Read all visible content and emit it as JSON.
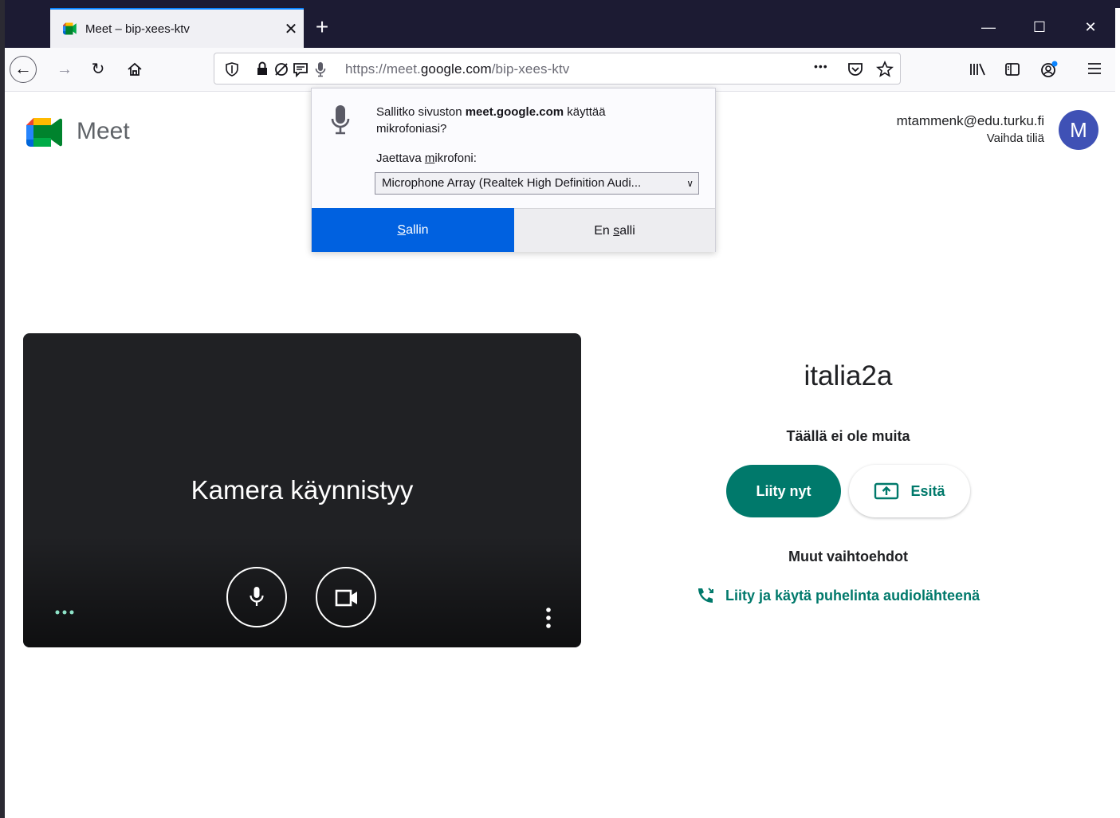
{
  "browser": {
    "tab_title": "Meet – bip-xees-ktv",
    "tab_close": "✕",
    "new_tab": "+",
    "window_controls": {
      "minimize": "—",
      "maximize": "☐",
      "close": "✕"
    },
    "url_prefix": "https://meet.",
    "url_domain": "google.com",
    "url_suffix": "/bip-xees-ktv",
    "url_more": "•••"
  },
  "permission_popup": {
    "question_prefix": "Sallitko sivuston ",
    "question_site": "meet.google.com",
    "question_suffix": " käyttää mikrofoniasi?",
    "mic_label_pre": "Jaettava ",
    "mic_label_key": "m",
    "mic_label_post": "ikrofoni:",
    "mic_selected": "Microphone Array (Realtek High Definition Audi...",
    "allow_key": "S",
    "allow_rest": "allin",
    "deny_pre": "En ",
    "deny_key": "s",
    "deny_post": "alli"
  },
  "header": {
    "app_name": "Meet",
    "account_email": "mtammenk@edu.turku.fi",
    "switch_account": "Vaihda tiliä",
    "avatar_letter": "M"
  },
  "preview": {
    "camera_status": "Kamera käynnistyy"
  },
  "join_panel": {
    "meeting_name": "italia2a",
    "participants_status": "Täällä ei ole muita",
    "join_button": "Liity nyt",
    "present_button": "Esitä",
    "other_options": "Muut vaihtoehdot",
    "phone_audio_link": "Liity ja käytä puhelinta audiolähteenä"
  },
  "colors": {
    "accent_teal": "#00796b",
    "allow_blue": "#0061e0",
    "avatar": "#3f51b5",
    "tabbar": "#1c1b33"
  }
}
